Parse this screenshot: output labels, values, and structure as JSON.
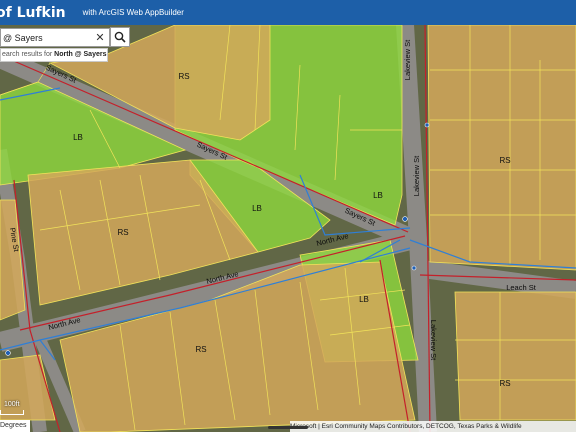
{
  "header": {
    "title": "of Lufkin",
    "subtitle": "with ArcGIS Web AppBuilder",
    "background": "#1d5fa8"
  },
  "search": {
    "value": "@ Sayers",
    "clear_icon": "close-icon",
    "search_icon": "search-icon",
    "suggestion_prefix": "earch results for ",
    "suggestion_term": "North @ Sayers",
    "suggestion_suffix": " ..."
  },
  "map": {
    "zones": {
      "ls": [
        "LB",
        "LB",
        "LB",
        "LB"
      ],
      "rs": [
        "RS",
        "RS",
        "RS",
        "RS",
        "RS"
      ]
    },
    "streets": {
      "sayers_1": "Sayers St",
      "sayers_2": "Sayers St",
      "sayers_3": "Sayers St",
      "north_ave_1": "North Ave",
      "north_ave_2": "North Ave",
      "north_ave_3": "North Ave",
      "lakeview_1": "Lakeview St",
      "lakeview_2": "Lakeview St",
      "leach": "Leach St",
      "pine": "Pine St"
    },
    "colors": {
      "lb_zone": "#8fdc3c",
      "rs_zone": "#d4a85a",
      "parcel_line": "#f2e35a",
      "road_centerline": "#c4202a",
      "utility_line": "#2f7fd6"
    }
  },
  "scalebar": {
    "label": "100ft"
  },
  "coords": {
    "text": "Degrees"
  },
  "attribution": {
    "text": "Microsoft | Esri Community Maps Contributors, DETCOG, Texas Parks & Wildlife"
  }
}
